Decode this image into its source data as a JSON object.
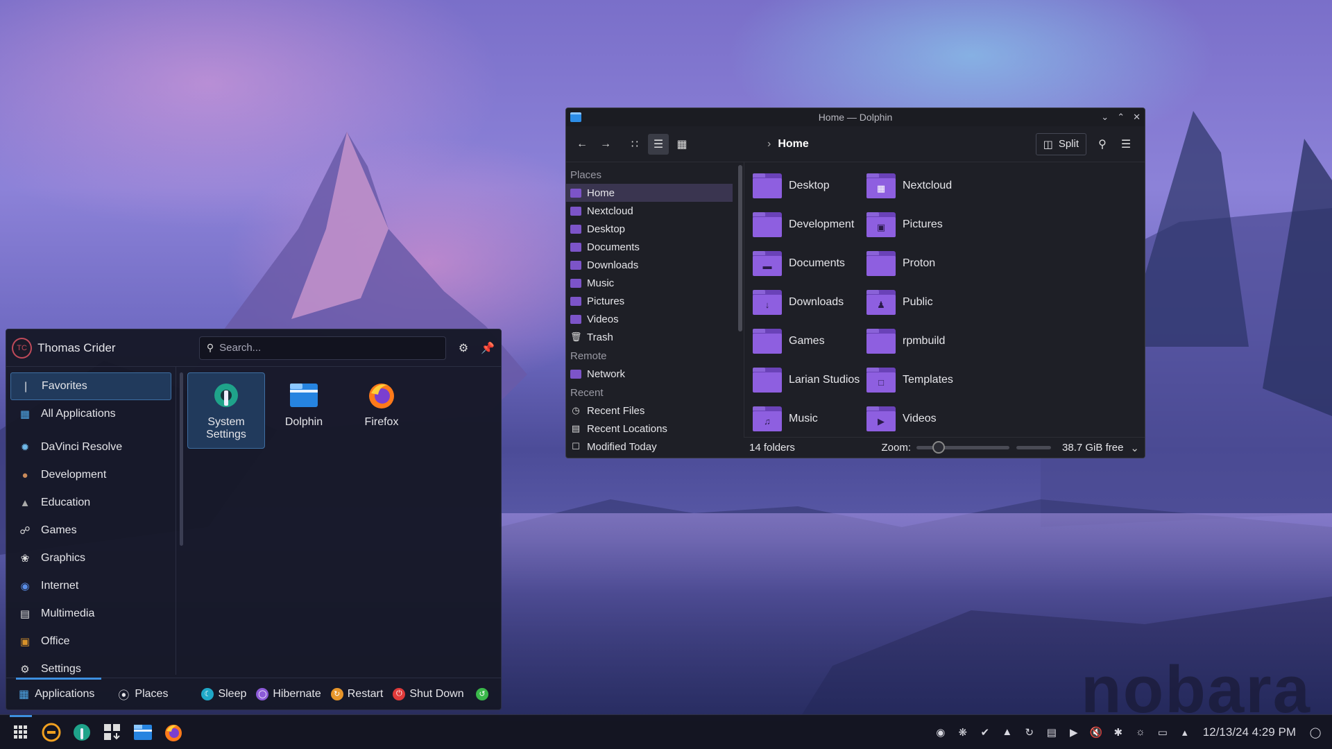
{
  "launcher": {
    "user_name": "Thomas Crider",
    "avatar_initials": "TC",
    "search_placeholder": "Search...",
    "categories": [
      {
        "label": "Favorites",
        "icon": "bookmark-icon"
      },
      {
        "label": "All Applications",
        "icon": "grid-icon"
      },
      {
        "label": "DaVinci Resolve",
        "icon": "davinci-icon"
      },
      {
        "label": "Development",
        "icon": "development-icon"
      },
      {
        "label": "Education",
        "icon": "graduation-cap-icon"
      },
      {
        "label": "Games",
        "icon": "gamepad-icon"
      },
      {
        "label": "Graphics",
        "icon": "palette-icon"
      },
      {
        "label": "Internet",
        "icon": "globe-icon"
      },
      {
        "label": "Multimedia",
        "icon": "multimedia-icon"
      },
      {
        "label": "Office",
        "icon": "briefcase-icon"
      },
      {
        "label": "Settings",
        "icon": "gear-icon"
      }
    ],
    "apps": [
      {
        "label": "System Settings",
        "icon": "system-settings-icon"
      },
      {
        "label": "Dolphin",
        "icon": "dolphin-icon"
      },
      {
        "label": "Firefox",
        "icon": "firefox-icon"
      }
    ],
    "footer": {
      "applications": "Applications",
      "places": "Places",
      "sleep": "Sleep",
      "hibernate": "Hibernate",
      "restart": "Restart",
      "shutdown": "Shut Down"
    }
  },
  "dolphin": {
    "title": "Home — Dolphin",
    "breadcrumb": "Home",
    "split_label": "Split",
    "places": {
      "places_header": "Places",
      "places_items": [
        "Home",
        "Nextcloud",
        "Desktop",
        "Documents",
        "Downloads",
        "Music",
        "Pictures",
        "Videos",
        "Trash"
      ],
      "remote_header": "Remote",
      "remote_items": [
        "Network"
      ],
      "recent_header": "Recent",
      "recent_items": [
        "Recent Files",
        "Recent Locations",
        "Modified Today"
      ]
    },
    "files": [
      {
        "name": "Desktop",
        "icon": "desktop-folder-icon"
      },
      {
        "name": "Nextcloud",
        "icon": "nextcloud-folder-icon"
      },
      {
        "name": "Development",
        "icon": "folder-icon"
      },
      {
        "name": "Pictures",
        "icon": "pictures-folder-icon"
      },
      {
        "name": "Documents",
        "icon": "documents-folder-icon"
      },
      {
        "name": "Proton",
        "icon": "folder-icon"
      },
      {
        "name": "Downloads",
        "icon": "downloads-folder-icon"
      },
      {
        "name": "Public",
        "icon": "public-folder-icon"
      },
      {
        "name": "Games",
        "icon": "folder-icon"
      },
      {
        "name": "rpmbuild",
        "icon": "folder-icon"
      },
      {
        "name": "Larian Studios",
        "icon": "folder-icon"
      },
      {
        "name": "Templates",
        "icon": "templates-folder-icon"
      },
      {
        "name": "Music",
        "icon": "music-folder-icon"
      },
      {
        "name": "Videos",
        "icon": "videos-folder-icon"
      }
    ],
    "status": {
      "count": "14 folders",
      "zoom_label": "Zoom:",
      "zoom_level": 0.2,
      "free_space": "38.7 GiB free"
    }
  },
  "taskbar": {
    "clock": "12/13/24 4:29 PM"
  },
  "wallpaper": {
    "watermark": "nobara"
  },
  "colors": {
    "accent": "#3d8fe0",
    "folder": "#8e5fe0",
    "selection": "#213a5c"
  }
}
